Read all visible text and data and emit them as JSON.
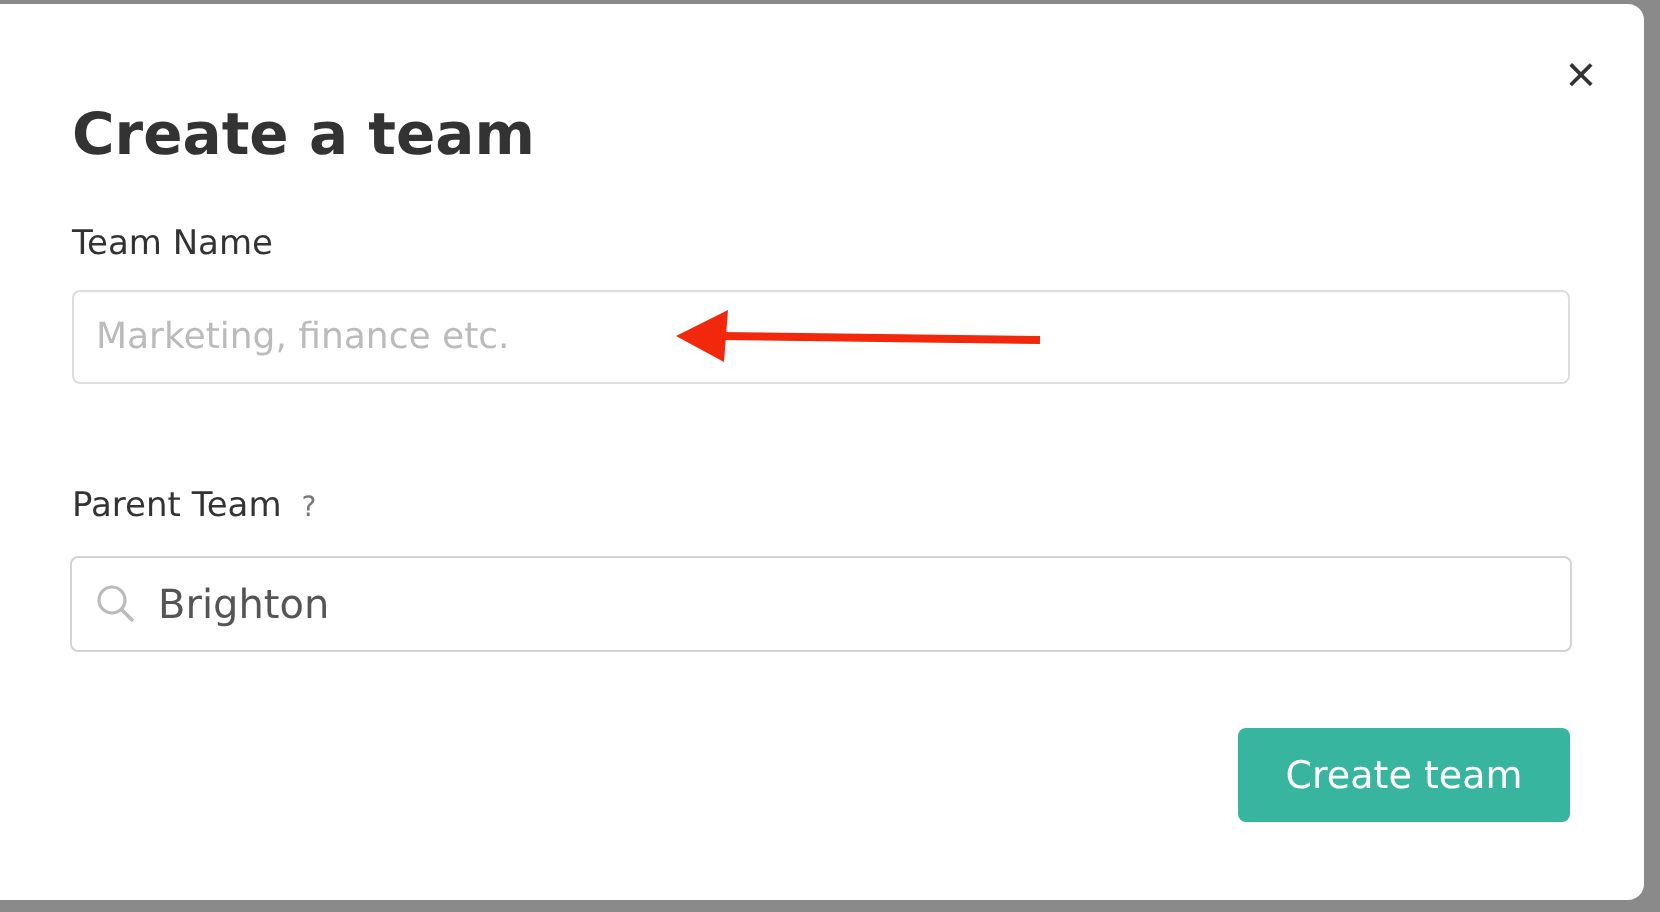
{
  "dialog": {
    "title": "Create a team",
    "close": "×",
    "team_name": {
      "label": "Team Name",
      "placeholder": "Marketing, finance etc."
    },
    "parent_team": {
      "label": "Parent Team",
      "help": "?",
      "value": "Brighton"
    },
    "submit": "Create team"
  }
}
